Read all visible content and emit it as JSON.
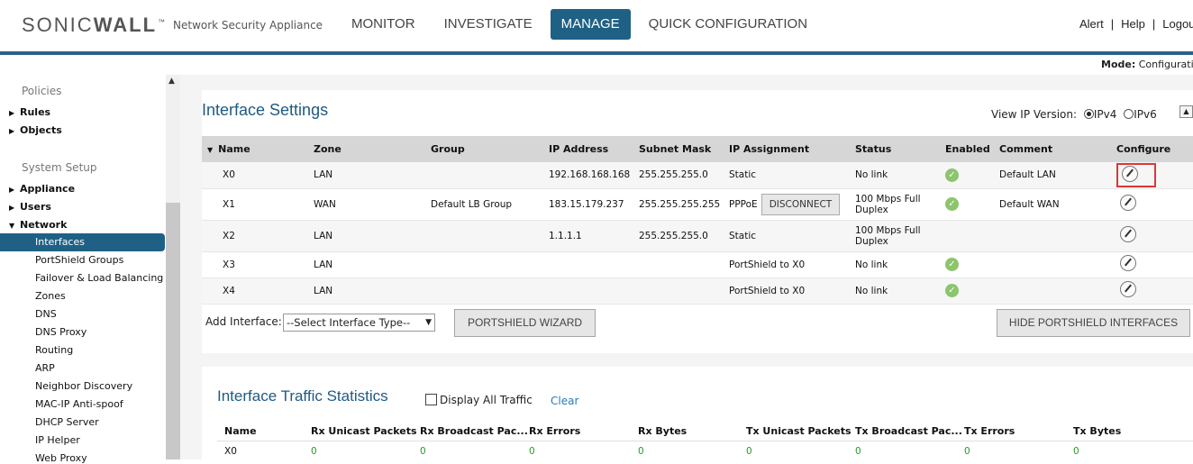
{
  "header": {
    "logo_light": "SONIC",
    "logo_bold": "WALL",
    "logo_tm": "™",
    "product": "Network Security Appliance",
    "nav": [
      {
        "label": "MONITOR"
      },
      {
        "label": "INVESTIGATE"
      },
      {
        "label": "MANAGE",
        "active": true
      },
      {
        "label": "QUICK CONFIGURATION"
      }
    ],
    "links": [
      "Alert",
      "Help",
      "Logout"
    ]
  },
  "mode": {
    "label": "Mode:",
    "value": "Configuration"
  },
  "sidebar": {
    "sections": [
      {
        "label": "Policies"
      },
      {
        "label": "System Setup"
      }
    ],
    "groups": [
      {
        "label": "Rules",
        "expanded": false
      },
      {
        "label": "Objects",
        "expanded": false
      },
      {
        "label": "Appliance",
        "expanded": false
      },
      {
        "label": "Users",
        "expanded": false
      },
      {
        "label": "Network",
        "expanded": true
      }
    ],
    "network_items": [
      {
        "label": "Interfaces",
        "active": true
      },
      {
        "label": "PortShield Groups"
      },
      {
        "label": "Failover & Load Balancing"
      },
      {
        "label": "Zones"
      },
      {
        "label": "DNS"
      },
      {
        "label": "DNS Proxy"
      },
      {
        "label": "Routing"
      },
      {
        "label": "ARP"
      },
      {
        "label": "Neighbor Discovery"
      },
      {
        "label": "MAC-IP Anti-spoof"
      },
      {
        "label": "DHCP Server"
      },
      {
        "label": "IP Helper"
      },
      {
        "label": "Web Proxy"
      }
    ]
  },
  "interface_settings": {
    "title": "Interface Settings",
    "ip_version_label": "View IP Version:",
    "ip_options": [
      "IPv4",
      "IPv6"
    ],
    "ip_selected": "IPv4",
    "columns": [
      "Name",
      "Zone",
      "Group",
      "IP Address",
      "Subnet Mask",
      "IP Assignment",
      "Status",
      "Enabled",
      "Comment",
      "Configure"
    ],
    "rows": [
      {
        "name": "X0",
        "zone": "LAN",
        "group": "",
        "ip": "192.168.168.168",
        "mask": "255.255.255.0",
        "assign": "Static",
        "status": "No link",
        "enabled": true,
        "comment": "Default LAN",
        "highlight": true
      },
      {
        "name": "X1",
        "zone": "WAN",
        "group": "Default LB Group",
        "ip": "183.15.179.237",
        "mask": "255.255.255.255",
        "assign": "PPPoE",
        "button": "DISCONNECT",
        "status": "100 Mbps Full Duplex",
        "enabled": true,
        "comment": "Default WAN"
      },
      {
        "name": "X2",
        "zone": "LAN",
        "group": "",
        "ip": "1.1.1.1",
        "mask": "255.255.255.0",
        "assign": "Static",
        "status": "100 Mbps Full Duplex",
        "enabled": false,
        "comment": ""
      },
      {
        "name": "X3",
        "zone": "LAN",
        "group": "",
        "ip": "",
        "mask": "",
        "assign": "PortShield to X0",
        "status": "No link",
        "enabled": true,
        "comment": ""
      },
      {
        "name": "X4",
        "zone": "LAN",
        "group": "",
        "ip": "",
        "mask": "",
        "assign": "PortShield to X0",
        "status": "No link",
        "enabled": true,
        "comment": ""
      }
    ],
    "add_interface_label": "Add Interface:",
    "add_interface_value": "--Select Interface Type--",
    "portshield_wizard": "PORTSHIELD WIZARD",
    "hide_portshield": "HIDE PORTSHIELD INTERFACES"
  },
  "traffic": {
    "title": "Interface Traffic Statistics",
    "display_all_label": "Display All Traffic",
    "clear_label": "Clear",
    "columns": [
      "Name",
      "Rx Unicast Packets",
      "Rx Broadcast Pac...",
      "Rx Errors",
      "Rx Bytes",
      "Tx Unicast Packets",
      "Tx Broadcast Pac...",
      "Tx Errors",
      "Tx Bytes"
    ],
    "rows": [
      {
        "name": "X0",
        "values": [
          "0",
          "0",
          "0",
          "0",
          "0",
          "0",
          "0",
          "0"
        ]
      }
    ]
  }
}
